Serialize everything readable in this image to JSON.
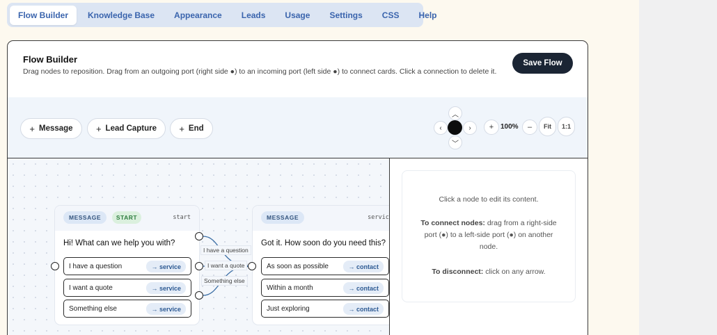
{
  "tabs": [
    "Flow Builder",
    "Knowledge Base",
    "Appearance",
    "Leads",
    "Usage",
    "Settings",
    "CSS",
    "Help"
  ],
  "active_tab": "Flow Builder",
  "panel": {
    "title": "Flow Builder",
    "description": "Drag nodes to reposition. Drag from an outgoing port (right side ●) to an incoming port (left side ●) to connect cards. Click a connection to delete it.",
    "save_label": "Save Flow"
  },
  "toolbar": {
    "add_message": "Message",
    "add_lead_capture": "Lead Capture",
    "add_end": "End",
    "zoom_in": "+",
    "zoom_level": "100%",
    "zoom_out": "–",
    "fit": "Fit",
    "reset": "1:1"
  },
  "nodes": [
    {
      "type": "MESSAGE",
      "start_badge": "START",
      "id": "start",
      "text": "Hi! What can we help you with?",
      "options": [
        {
          "label": "I have a question",
          "target": "→ service"
        },
        {
          "label": "I want a quote",
          "target": "→ service"
        },
        {
          "label": "Something else",
          "target": "→ service"
        }
      ]
    },
    {
      "type": "MESSAGE",
      "id": "service",
      "text": "Got it. How soon do you need this?",
      "options": [
        {
          "label": "As soon as possible",
          "target": "→ contact"
        },
        {
          "label": "Within a month",
          "target": "→ contact"
        },
        {
          "label": "Just exploring",
          "target": "→ contact"
        }
      ]
    }
  ],
  "edge_labels": [
    "I have a question",
    "I want a quote",
    "Something else"
  ],
  "side_panel": {
    "hint": "Click a node to edit its content.",
    "connect_title": "To connect nodes:",
    "connect_text": "drag from a right-side port (●) to a left-side port (●) on another node.",
    "disconnect_title": "To disconnect:",
    "disconnect_text": "click on any arrow."
  },
  "colors": {
    "accent": "#3a64ad",
    "save_button": "#1b2534",
    "target_pill_bg": "#e4ecf7",
    "start_badge_bg": "#dbf0de"
  }
}
